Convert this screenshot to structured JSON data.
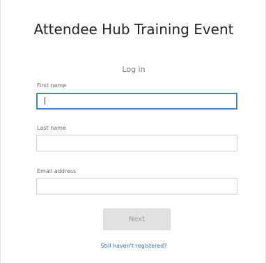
{
  "event": {
    "title": "Attendee Hub Training Event"
  },
  "login": {
    "subtitle": "Log in"
  },
  "form": {
    "first_name": {
      "label": "First name",
      "value": ""
    },
    "last_name": {
      "label": "Last name",
      "value": ""
    },
    "email": {
      "label": "Email address",
      "value": ""
    }
  },
  "actions": {
    "next_label": "Next",
    "register_link": "Still haven't registered?"
  }
}
